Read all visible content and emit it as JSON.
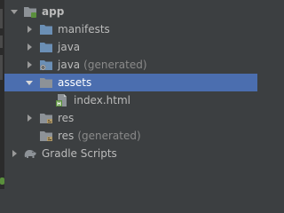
{
  "tree": {
    "items": [
      {
        "label": "app",
        "suffix": "",
        "expanded": true,
        "selected": false,
        "icon": "module-folder-icon",
        "bold": true
      },
      {
        "label": "manifests",
        "suffix": "",
        "expanded": false,
        "selected": false,
        "icon": "folder-icon",
        "bold": false
      },
      {
        "label": "java",
        "suffix": "",
        "expanded": false,
        "selected": false,
        "icon": "source-folder-icon",
        "bold": false
      },
      {
        "label": "java",
        "suffix": "(generated)",
        "expanded": false,
        "selected": false,
        "icon": "generated-source-folder-icon",
        "bold": false
      },
      {
        "label": "assets",
        "suffix": "",
        "expanded": true,
        "selected": true,
        "icon": "folder-icon",
        "bold": false
      },
      {
        "label": "index.html",
        "suffix": "",
        "expanded": null,
        "selected": false,
        "icon": "html-file-icon",
        "bold": false
      },
      {
        "label": "res",
        "suffix": "",
        "expanded": false,
        "selected": false,
        "icon": "resource-folder-icon",
        "bold": false
      },
      {
        "label": "res",
        "suffix": "(generated)",
        "expanded": null,
        "selected": false,
        "icon": "generated-resource-folder-icon",
        "bold": false
      },
      {
        "label": "Gradle Scripts",
        "suffix": "",
        "expanded": false,
        "selected": false,
        "icon": "gradle-elephant-icon",
        "bold": false
      }
    ]
  },
  "colors": {
    "background": "#3c3f41",
    "selection": "#4b6eaf",
    "text": "#bbbbbb",
    "suffix_text": "#8a8a8a",
    "folder_blue": "#6b8fb5",
    "folder_gray": "#8d9297",
    "html_badge": "#5a8f3c"
  }
}
